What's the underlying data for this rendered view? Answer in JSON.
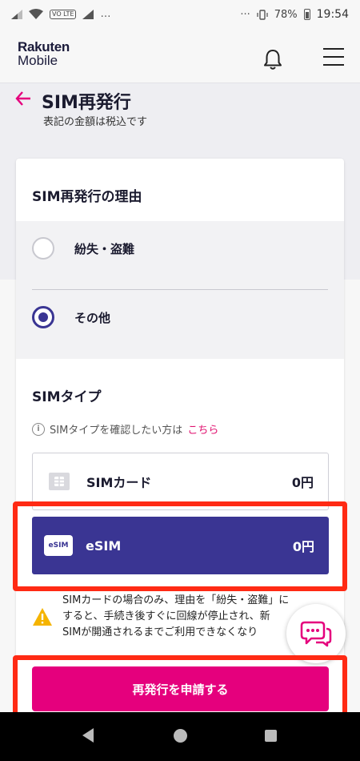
{
  "status_bar": {
    "lte_label": "VO LTE",
    "more": "…",
    "right_more": "···",
    "battery": "78%",
    "time": "19:54"
  },
  "header": {
    "logo_line1": "Rakuten",
    "logo_line2": "Mobile"
  },
  "page": {
    "title": "SIM再発行",
    "subtitle": "表記の金額は税込です"
  },
  "reason": {
    "title": "SIM再発行の理由",
    "options": [
      {
        "label": "紛失・盗難",
        "selected": false
      },
      {
        "label": "その他",
        "selected": true
      }
    ]
  },
  "sim_type": {
    "title": "SIMタイプ",
    "info_text": "SIMタイプを確認したい方は",
    "info_link": "こちら",
    "options": [
      {
        "label": "SIMカード",
        "price": "0円",
        "selected": false,
        "icon": "sim-card-icon"
      },
      {
        "label": "eSIM",
        "price": "0円",
        "selected": true,
        "icon": "esim-icon",
        "badge": "eSIM"
      }
    ]
  },
  "warning": {
    "lines": [
      "SIMカードの場合のみ、理由を「紛失・盗難」に",
      "すると、手続き後すぐに回線が停止され、新",
      "SIMが開通されるまでご利用できなくなり"
    ]
  },
  "cta": {
    "label": "再発行を申請する"
  },
  "colors": {
    "brand_navy": "#3a3593",
    "brand_magenta": "#e5007d",
    "highlight_red": "#ff2a14"
  }
}
